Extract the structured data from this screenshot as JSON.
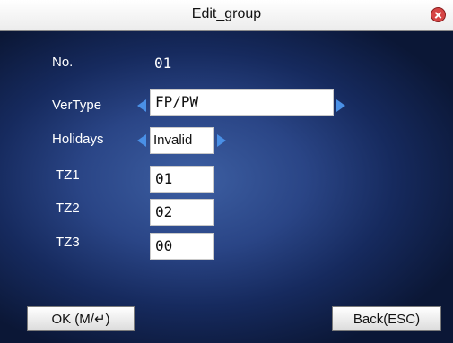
{
  "title": "Edit_group",
  "fields": {
    "no": {
      "label": "No.",
      "value": "01"
    },
    "vertype": {
      "label": "VerType",
      "value": "FP/PW"
    },
    "holidays": {
      "label": "Holidays",
      "value": "Invalid"
    },
    "tz1": {
      "label": "TZ1",
      "value": "01"
    },
    "tz2": {
      "label": "TZ2",
      "value": "02"
    },
    "tz3": {
      "label": "TZ3",
      "value": "00"
    }
  },
  "buttons": {
    "ok": "OK (M/↵)",
    "back": "Back(ESC)"
  },
  "colors": {
    "accent_arrow": "#4a90e6",
    "close_red": "#d64545"
  }
}
